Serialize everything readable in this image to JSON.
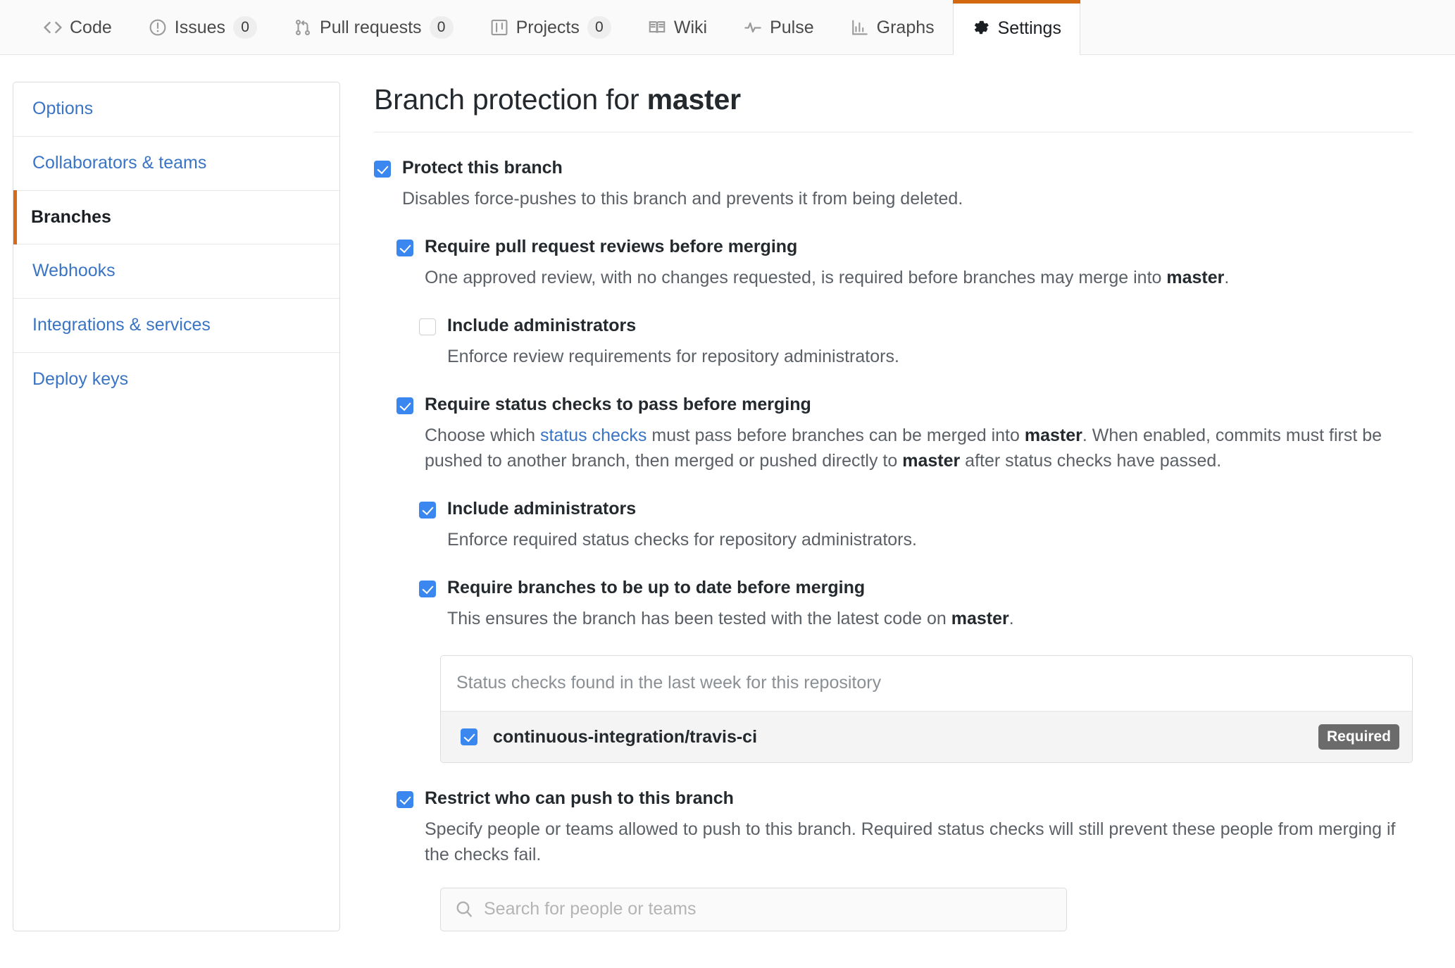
{
  "repo_nav": {
    "tabs": [
      {
        "label": "Code",
        "icon": "code-icon",
        "count": null,
        "active": false
      },
      {
        "label": "Issues",
        "icon": "issue-opened-icon",
        "count": "0",
        "active": false
      },
      {
        "label": "Pull requests",
        "icon": "git-pull-request-icon",
        "count": "0",
        "active": false
      },
      {
        "label": "Projects",
        "icon": "project-icon",
        "count": "0",
        "active": false
      },
      {
        "label": "Wiki",
        "icon": "book-icon",
        "count": null,
        "active": false
      },
      {
        "label": "Pulse",
        "icon": "pulse-icon",
        "count": null,
        "active": false
      },
      {
        "label": "Graphs",
        "icon": "graph-icon",
        "count": null,
        "active": false
      },
      {
        "label": "Settings",
        "icon": "gear-icon",
        "count": null,
        "active": true
      }
    ]
  },
  "sidebar": {
    "items": [
      {
        "label": "Options",
        "active": false
      },
      {
        "label": "Collaborators & teams",
        "active": false
      },
      {
        "label": "Branches",
        "active": true
      },
      {
        "label": "Webhooks",
        "active": false
      },
      {
        "label": "Integrations & services",
        "active": false
      },
      {
        "label": "Deploy keys",
        "active": false
      }
    ]
  },
  "main": {
    "title_prefix": "Branch protection for ",
    "branch_name": "master",
    "protect": {
      "label": "Protect this branch",
      "checked": true,
      "description": "Disables force-pushes to this branch and prevents it from being deleted."
    },
    "require_reviews": {
      "label": "Require pull request reviews before merging",
      "checked": true,
      "desc_part1": "One approved review, with no changes requested, is required before branches may merge into ",
      "desc_bold": "master",
      "desc_part2": ".",
      "include_admins": {
        "label": "Include administrators",
        "checked": false,
        "description": "Enforce review requirements for repository administrators."
      }
    },
    "require_status_checks": {
      "label": "Require status checks to pass before merging",
      "checked": true,
      "desc_part1": "Choose which ",
      "desc_link": "status checks",
      "desc_part2": " must pass before branches can be merged into ",
      "desc_bold1": "master",
      "desc_part3": ". When enabled, commits must first be pushed to another branch, then merged or pushed directly to ",
      "desc_bold2": "master",
      "desc_part4": " after status checks have passed.",
      "include_admins": {
        "label": "Include administrators",
        "checked": true,
        "description": "Enforce required status checks for repository administrators."
      },
      "up_to_date": {
        "label": "Require branches to be up to date before merging",
        "checked": true,
        "desc_part1": "This ensures the branch has been tested with the latest code on ",
        "desc_bold": "master",
        "desc_part2": "."
      },
      "checks_list": {
        "header": "Status checks found in the last week for this repository",
        "rows": [
          {
            "name": "continuous-integration/travis-ci",
            "checked": true,
            "badge": "Required"
          }
        ]
      }
    },
    "restrict_push": {
      "label": "Restrict who can push to this branch",
      "checked": true,
      "description": "Specify people or teams allowed to push to this branch. Required status checks will still prevent these people from merging if the checks fail.",
      "search_placeholder": "Search for people or teams"
    }
  },
  "colors": {
    "accent_orange": "#d26911",
    "link_blue": "#3a74c4",
    "checkbox_blue": "#3b87f0",
    "badge_gray": "#6b6b6b"
  }
}
